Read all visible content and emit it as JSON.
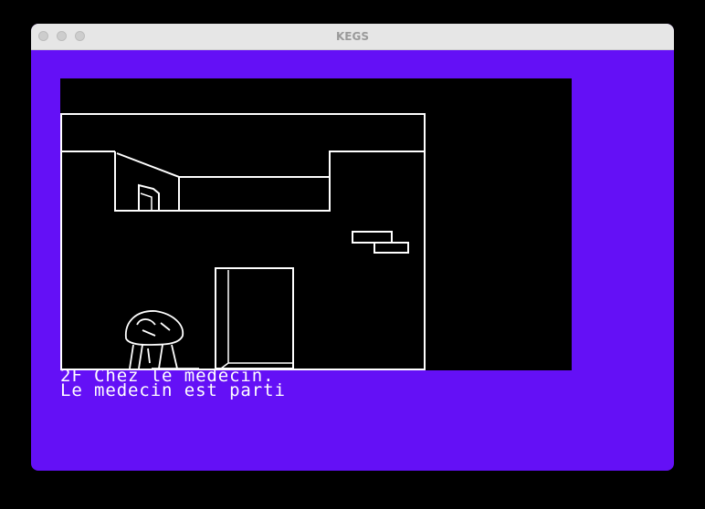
{
  "window": {
    "title": "KEGS",
    "colors": {
      "border": "#6410f6",
      "screen": "#000000",
      "ink": "#ffffff",
      "titlebar": "#e6e6e6"
    }
  },
  "game": {
    "scene": "room with doctor's office",
    "status_lines": [
      "2F Chez le medecin.",
      "Le medecin est parti"
    ]
  }
}
